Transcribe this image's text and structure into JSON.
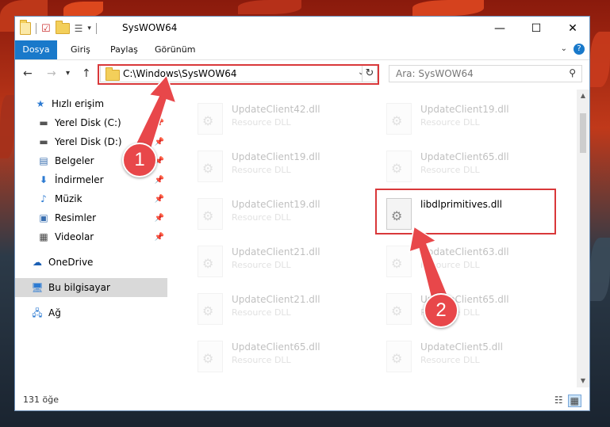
{
  "window": {
    "title": "SysWOW64",
    "controls": {
      "minimize": "—",
      "maximize": "☐",
      "close": "✕"
    }
  },
  "ribbon": {
    "tabs": [
      "Dosya",
      "Giriş",
      "Paylaş",
      "Görünüm"
    ],
    "help": "?"
  },
  "nav": {
    "back": "←",
    "forward": "→",
    "recent": "▾",
    "up": "↑",
    "address": "C:\\Windows\\SysWOW64",
    "address_dropdown": "⌄",
    "refresh": "↻",
    "search_placeholder": "Ara: SysWOW64"
  },
  "sidebar": {
    "items": [
      {
        "label": "Hızlı erişim",
        "icon": "star-icon",
        "pinned": false
      },
      {
        "label": "Yerel Disk (C:)",
        "icon": "drive-icon",
        "pinned": true
      },
      {
        "label": "Yerel Disk (D:)",
        "icon": "drive-icon",
        "pinned": true
      },
      {
        "label": "Belgeler",
        "icon": "documents-icon",
        "pinned": true
      },
      {
        "label": "İndirmeler",
        "icon": "downloads-icon",
        "pinned": true
      },
      {
        "label": "Müzik",
        "icon": "music-icon",
        "pinned": true
      },
      {
        "label": "Resimler",
        "icon": "pictures-icon",
        "pinned": true
      },
      {
        "label": "Videolar",
        "icon": "videos-icon",
        "pinned": true
      },
      {
        "label": "OneDrive",
        "icon": "cloud-icon",
        "pinned": false
      },
      {
        "label": "Bu bilgisayar",
        "icon": "computer-icon",
        "pinned": false,
        "selected": true
      },
      {
        "label": "Ağ",
        "icon": "network-icon",
        "pinned": false
      }
    ]
  },
  "files": {
    "left": [
      {
        "name": "UpdateClient42.dll",
        "type": "Resource DLL"
      },
      {
        "name": "UpdateClient19.dll",
        "type": "Resource DLL"
      },
      {
        "name": "UpdateClient19.dll",
        "type": "Resource DLL"
      },
      {
        "name": "UpdateClient21.dll",
        "type": "Resource DLL"
      },
      {
        "name": "UpdateClient21.dll",
        "type": "Resource DLL"
      },
      {
        "name": "UpdateClient65.dll",
        "type": "Resource DLL"
      }
    ],
    "right": [
      {
        "name": "UpdateClient19.dll",
        "type": "Resource DLL"
      },
      {
        "name": "UpdateClient65.dll",
        "type": "Resource DLL"
      },
      {
        "name": "libdlprimitives.dll",
        "type": ""
      },
      {
        "name": "UpdateClient63.dll",
        "type": "Resource DLL"
      },
      {
        "name": "UpdateClient65.dll",
        "type": "Resource DLL"
      },
      {
        "name": "UpdateClient5.dll",
        "type": "Resource DLL"
      }
    ]
  },
  "status": {
    "count": "131 öğe"
  },
  "annotations": {
    "step1": "1",
    "step2": "2",
    "color": "#d9383a"
  }
}
